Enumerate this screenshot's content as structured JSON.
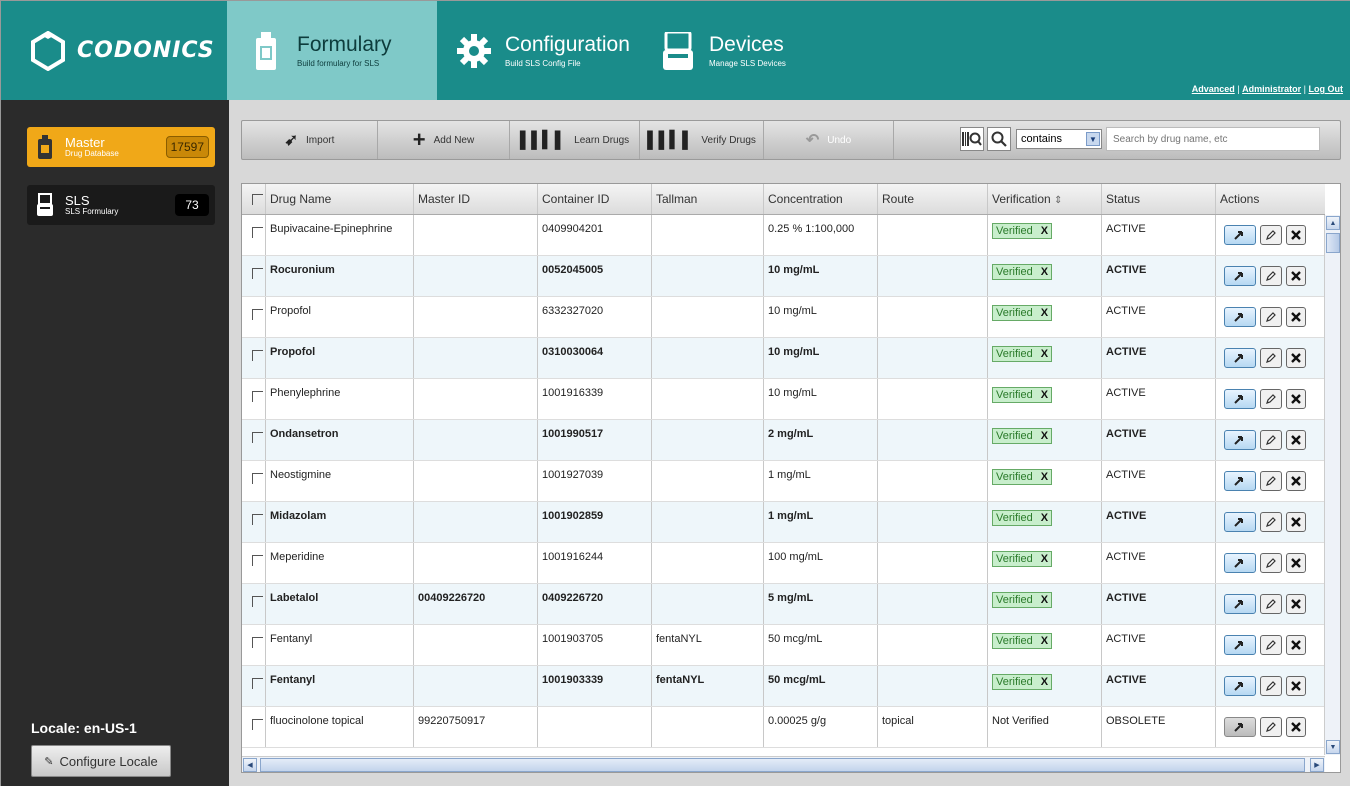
{
  "header": {
    "logo_text": "CODONICS",
    "tabs": [
      {
        "title": "Formulary",
        "subtitle": "Build formulary for SLS"
      },
      {
        "title": "Configuration",
        "subtitle": "Build SLS Config File"
      },
      {
        "title": "Devices",
        "subtitle": "Manage SLS Devices"
      }
    ],
    "links": [
      "Advanced",
      "Administrator",
      "Log Out"
    ],
    "link_separator": "|"
  },
  "sidebar": {
    "databases": [
      {
        "name": "Master",
        "subtitle": "Drug Database",
        "count": "17597"
      },
      {
        "name": "SLS",
        "subtitle": "SLS Formulary",
        "count": "73"
      }
    ],
    "locale_label": "Locale: en-US-1",
    "configure_locale_label": "Configure Locale"
  },
  "toolbar": {
    "import_label": "Import",
    "add_new_label": "Add New",
    "learn_drugs_label": "Learn Drugs",
    "verify_drugs_label": "Verify Drugs",
    "undo_label": "Undo",
    "search_mode": "contains",
    "search_placeholder": "Search by drug name, etc"
  },
  "table": {
    "columns": [
      "Drug Name",
      "Master ID",
      "Container ID",
      "Tallman",
      "Concentration",
      "Route",
      "Verification",
      "Status",
      "Actions"
    ],
    "sort_indicator": "⇕",
    "verify_x": "X",
    "rows": [
      {
        "drug": "Bupivacaine-Epinephrine",
        "master_id": "",
        "container_id": "0409904201",
        "tallman": "",
        "concentration": "0.25 %   1:100,000",
        "route": "",
        "verification": "Verified",
        "status": "ACTIVE",
        "bold": false
      },
      {
        "drug": "Rocuronium",
        "master_id": "",
        "container_id": "0052045005",
        "tallman": "",
        "concentration": "10 mg/mL",
        "route": "",
        "verification": "Verified",
        "status": "ACTIVE",
        "bold": true
      },
      {
        "drug": "Propofol",
        "master_id": "",
        "container_id": "6332327020",
        "tallman": "",
        "concentration": "10 mg/mL",
        "route": "",
        "verification": "Verified",
        "status": "ACTIVE",
        "bold": false
      },
      {
        "drug": "Propofol",
        "master_id": "",
        "container_id": "0310030064",
        "tallman": "",
        "concentration": "10 mg/mL",
        "route": "",
        "verification": "Verified",
        "status": "ACTIVE",
        "bold": true
      },
      {
        "drug": "Phenylephrine",
        "master_id": "",
        "container_id": "1001916339",
        "tallman": "",
        "concentration": "10 mg/mL",
        "route": "",
        "verification": "Verified",
        "status": "ACTIVE",
        "bold": false
      },
      {
        "drug": "Ondansetron",
        "master_id": "",
        "container_id": "1001990517",
        "tallman": "",
        "concentration": "2 mg/mL",
        "route": "",
        "verification": "Verified",
        "status": "ACTIVE",
        "bold": true
      },
      {
        "drug": "Neostigmine",
        "master_id": "",
        "container_id": "1001927039",
        "tallman": "",
        "concentration": "1 mg/mL",
        "route": "",
        "verification": "Verified",
        "status": "ACTIVE",
        "bold": false
      },
      {
        "drug": "Midazolam",
        "master_id": "",
        "container_id": "1001902859",
        "tallman": "",
        "concentration": "1 mg/mL",
        "route": "",
        "verification": "Verified",
        "status": "ACTIVE",
        "bold": true
      },
      {
        "drug": "Meperidine",
        "master_id": "",
        "container_id": "1001916244",
        "tallman": "",
        "concentration": "100 mg/mL",
        "route": "",
        "verification": "Verified",
        "status": "ACTIVE",
        "bold": false
      },
      {
        "drug": "Labetalol",
        "master_id": "00409226720",
        "container_id": "0409226720",
        "tallman": "",
        "concentration": "5 mg/mL",
        "route": "",
        "verification": "Verified",
        "status": "ACTIVE",
        "bold": true
      },
      {
        "drug": "Fentanyl",
        "master_id": "",
        "container_id": "1001903705",
        "tallman": "fentaNYL",
        "concentration": "50 mcg/mL",
        "route": "",
        "verification": "Verified",
        "status": "ACTIVE",
        "bold": false
      },
      {
        "drug": "Fentanyl",
        "master_id": "",
        "container_id": "1001903339",
        "tallman": "fentaNYL",
        "concentration": "50 mcg/mL",
        "route": "",
        "verification": "Verified",
        "status": "ACTIVE",
        "bold": true
      },
      {
        "drug": "fluocinolone topical",
        "master_id": "99220750917",
        "container_id": "",
        "tallman": "",
        "concentration": "0.00025 g/g",
        "route": "topical",
        "verification": "Not Verified",
        "status": "OBSOLETE",
        "bold": false
      }
    ]
  },
  "colors": {
    "header_teal": "#1a8c8a",
    "formulary_tab": "#7fc9c8",
    "master_orange": "#f0a818",
    "verified_green": "#c8eecc"
  }
}
